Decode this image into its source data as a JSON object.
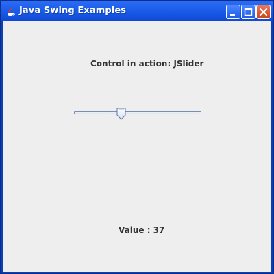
{
  "window": {
    "title": "Java Swing Examples",
    "icon": "java-cup-icon",
    "buttons": {
      "minimize_icon": "minimize-icon",
      "maximize_icon": "maximize-icon",
      "close_icon": "close-icon"
    }
  },
  "content": {
    "header_label": "Control in action: JSlider",
    "slider": {
      "min": 0,
      "max": 100,
      "value": 37
    },
    "status_label": "Value : 37"
  },
  "colors": {
    "titlebar": "#1b5de8",
    "client_background": "#eeeeee",
    "close_button": "#d95a35"
  }
}
